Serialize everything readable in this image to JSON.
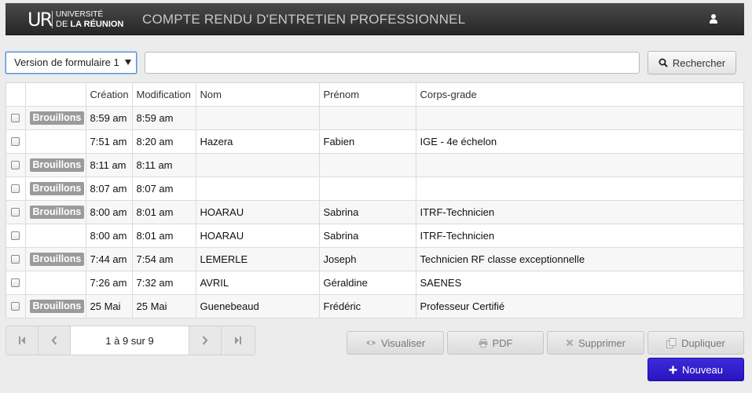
{
  "header": {
    "logo_mark": "UR",
    "logo_line1": "UNIVERSITÉ",
    "logo_line2_prefix": "DE",
    "logo_line2_bold": "LA RÉUNION",
    "title": "COMPTE RENDU D'ENTRETIEN PROFESSIONNEL",
    "user_icon": "user-icon"
  },
  "toolbar": {
    "version_select": "Version de formulaire 1",
    "search_value": "",
    "search_label": "Rechercher"
  },
  "table": {
    "columns": [
      "",
      "",
      "Création",
      "Modification",
      "Nom",
      "Prénom",
      "Corps-grade"
    ],
    "rows": [
      {
        "status": "Brouillons",
        "creation": "8:59 am",
        "modification": "8:59 am",
        "nom": "",
        "prenom": "",
        "corps": ""
      },
      {
        "status": "",
        "creation": "7:51 am",
        "modification": "8:20 am",
        "nom": "Hazera",
        "prenom": "Fabien",
        "corps": "IGE - 4e échelon"
      },
      {
        "status": "Brouillons",
        "creation": "8:11 am",
        "modification": "8:11 am",
        "nom": "",
        "prenom": "",
        "corps": ""
      },
      {
        "status": "Brouillons",
        "creation": "8:07 am",
        "modification": "8:07 am",
        "nom": "",
        "prenom": "",
        "corps": ""
      },
      {
        "status": "Brouillons",
        "creation": "8:00 am",
        "modification": "8:01 am",
        "nom": "HOARAU",
        "prenom": "Sabrina",
        "corps": "ITRF-Technicien"
      },
      {
        "status": "",
        "creation": "8:00 am",
        "modification": "8:01 am",
        "nom": "HOARAU",
        "prenom": "Sabrina",
        "corps": "ITRF-Technicien"
      },
      {
        "status": "Brouillons",
        "creation": "7:44 am",
        "modification": "7:54 am",
        "nom": "LEMERLE",
        "prenom": "Joseph",
        "corps": "Technicien RF classe exceptionnelle"
      },
      {
        "status": "",
        "creation": "7:26 am",
        "modification": "7:32 am",
        "nom": "AVRIL",
        "prenom": "Géraldine",
        "corps": "SAENES"
      },
      {
        "status": "Brouillons",
        "creation": "25 Mai",
        "modification": "25 Mai",
        "nom": "Guenebeaud",
        "prenom": "Frédéric",
        "corps": "Professeur Certifié"
      }
    ]
  },
  "pager": {
    "info": "1 à 9 sur 9"
  },
  "actions": {
    "visualiser": "Visualiser",
    "pdf": "PDF",
    "supprimer": "Supprimer",
    "dupliquer": "Dupliquer",
    "nouveau": "Nouveau"
  },
  "colors": {
    "header_bg": "#2d2d2d",
    "primary": "#3321cf",
    "badge": "#9b9b9b"
  }
}
